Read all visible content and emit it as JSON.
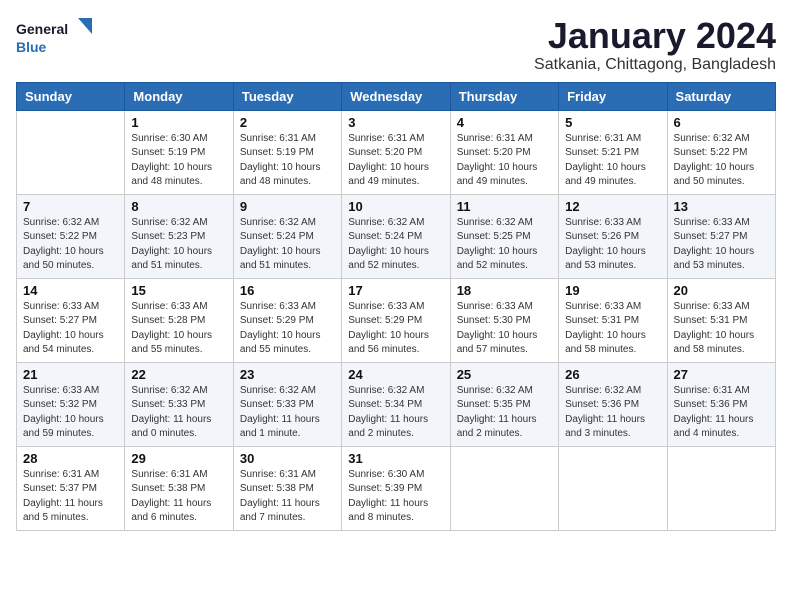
{
  "header": {
    "logo_line1": "General",
    "logo_line2": "Blue",
    "month": "January 2024",
    "location": "Satkania, Chittagong, Bangladesh"
  },
  "weekdays": [
    "Sunday",
    "Monday",
    "Tuesday",
    "Wednesday",
    "Thursday",
    "Friday",
    "Saturday"
  ],
  "weeks": [
    [
      {
        "day": "",
        "content": ""
      },
      {
        "day": "1",
        "content": "Sunrise: 6:30 AM\nSunset: 5:19 PM\nDaylight: 10 hours\nand 48 minutes."
      },
      {
        "day": "2",
        "content": "Sunrise: 6:31 AM\nSunset: 5:19 PM\nDaylight: 10 hours\nand 48 minutes."
      },
      {
        "day": "3",
        "content": "Sunrise: 6:31 AM\nSunset: 5:20 PM\nDaylight: 10 hours\nand 49 minutes."
      },
      {
        "day": "4",
        "content": "Sunrise: 6:31 AM\nSunset: 5:20 PM\nDaylight: 10 hours\nand 49 minutes."
      },
      {
        "day": "5",
        "content": "Sunrise: 6:31 AM\nSunset: 5:21 PM\nDaylight: 10 hours\nand 49 minutes."
      },
      {
        "day": "6",
        "content": "Sunrise: 6:32 AM\nSunset: 5:22 PM\nDaylight: 10 hours\nand 50 minutes."
      }
    ],
    [
      {
        "day": "7",
        "content": "Sunrise: 6:32 AM\nSunset: 5:22 PM\nDaylight: 10 hours\nand 50 minutes."
      },
      {
        "day": "8",
        "content": "Sunrise: 6:32 AM\nSunset: 5:23 PM\nDaylight: 10 hours\nand 51 minutes."
      },
      {
        "day": "9",
        "content": "Sunrise: 6:32 AM\nSunset: 5:24 PM\nDaylight: 10 hours\nand 51 minutes."
      },
      {
        "day": "10",
        "content": "Sunrise: 6:32 AM\nSunset: 5:24 PM\nDaylight: 10 hours\nand 52 minutes."
      },
      {
        "day": "11",
        "content": "Sunrise: 6:32 AM\nSunset: 5:25 PM\nDaylight: 10 hours\nand 52 minutes."
      },
      {
        "day": "12",
        "content": "Sunrise: 6:33 AM\nSunset: 5:26 PM\nDaylight: 10 hours\nand 53 minutes."
      },
      {
        "day": "13",
        "content": "Sunrise: 6:33 AM\nSunset: 5:27 PM\nDaylight: 10 hours\nand 53 minutes."
      }
    ],
    [
      {
        "day": "14",
        "content": "Sunrise: 6:33 AM\nSunset: 5:27 PM\nDaylight: 10 hours\nand 54 minutes."
      },
      {
        "day": "15",
        "content": "Sunrise: 6:33 AM\nSunset: 5:28 PM\nDaylight: 10 hours\nand 55 minutes."
      },
      {
        "day": "16",
        "content": "Sunrise: 6:33 AM\nSunset: 5:29 PM\nDaylight: 10 hours\nand 55 minutes."
      },
      {
        "day": "17",
        "content": "Sunrise: 6:33 AM\nSunset: 5:29 PM\nDaylight: 10 hours\nand 56 minutes."
      },
      {
        "day": "18",
        "content": "Sunrise: 6:33 AM\nSunset: 5:30 PM\nDaylight: 10 hours\nand 57 minutes."
      },
      {
        "day": "19",
        "content": "Sunrise: 6:33 AM\nSunset: 5:31 PM\nDaylight: 10 hours\nand 58 minutes."
      },
      {
        "day": "20",
        "content": "Sunrise: 6:33 AM\nSunset: 5:31 PM\nDaylight: 10 hours\nand 58 minutes."
      }
    ],
    [
      {
        "day": "21",
        "content": "Sunrise: 6:33 AM\nSunset: 5:32 PM\nDaylight: 10 hours\nand 59 minutes."
      },
      {
        "day": "22",
        "content": "Sunrise: 6:32 AM\nSunset: 5:33 PM\nDaylight: 11 hours\nand 0 minutes."
      },
      {
        "day": "23",
        "content": "Sunrise: 6:32 AM\nSunset: 5:33 PM\nDaylight: 11 hours\nand 1 minute."
      },
      {
        "day": "24",
        "content": "Sunrise: 6:32 AM\nSunset: 5:34 PM\nDaylight: 11 hours\nand 2 minutes."
      },
      {
        "day": "25",
        "content": "Sunrise: 6:32 AM\nSunset: 5:35 PM\nDaylight: 11 hours\nand 2 minutes."
      },
      {
        "day": "26",
        "content": "Sunrise: 6:32 AM\nSunset: 5:36 PM\nDaylight: 11 hours\nand 3 minutes."
      },
      {
        "day": "27",
        "content": "Sunrise: 6:31 AM\nSunset: 5:36 PM\nDaylight: 11 hours\nand 4 minutes."
      }
    ],
    [
      {
        "day": "28",
        "content": "Sunrise: 6:31 AM\nSunset: 5:37 PM\nDaylight: 11 hours\nand 5 minutes."
      },
      {
        "day": "29",
        "content": "Sunrise: 6:31 AM\nSunset: 5:38 PM\nDaylight: 11 hours\nand 6 minutes."
      },
      {
        "day": "30",
        "content": "Sunrise: 6:31 AM\nSunset: 5:38 PM\nDaylight: 11 hours\nand 7 minutes."
      },
      {
        "day": "31",
        "content": "Sunrise: 6:30 AM\nSunset: 5:39 PM\nDaylight: 11 hours\nand 8 minutes."
      },
      {
        "day": "",
        "content": ""
      },
      {
        "day": "",
        "content": ""
      },
      {
        "day": "",
        "content": ""
      }
    ]
  ]
}
